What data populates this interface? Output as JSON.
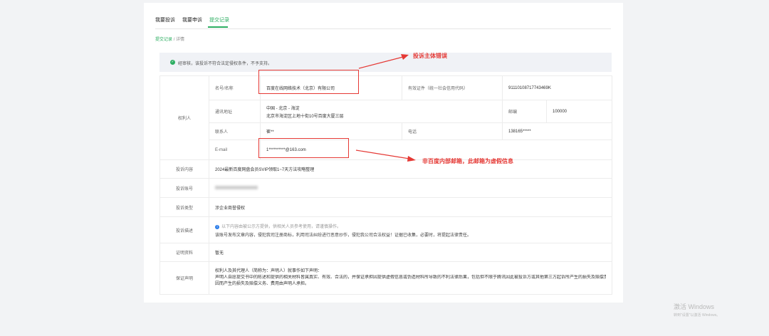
{
  "tabs": [
    {
      "label": "我要投诉"
    },
    {
      "label": "我要申诉"
    },
    {
      "label": "提交记录",
      "active": true
    }
  ],
  "breadcrumb": {
    "back": "提交记录",
    "separator": "/",
    "current": "详情"
  },
  "notice": {
    "status_icon": "check-circle-icon",
    "text": "经审核，该投诉不符合法定侵权条件，不予支持。"
  },
  "rights_holder": {
    "section_label": "权利人",
    "name_label": "名号/名称",
    "name_value": "百度在线网络技术（北京）有限公司",
    "cert_label": "有效证件（统一社会信用代码）",
    "cert_value": "91110108717743469K",
    "address_label": "通讯地址",
    "address_region": "中国 - 北京 - 海淀",
    "address_detail": "北京市海淀区上地十街10号百度大厦三层",
    "postcode_label": "邮编",
    "postcode_value": "100000",
    "contact_label": "联系人",
    "contact_value": "崔**",
    "phone_label": "电话",
    "phone_value": "138165*****",
    "email_label": "E-mail",
    "email_value": "1**********@163.com"
  },
  "rows": {
    "content_label": "投诉内容",
    "content_value": "2024最新百度网盘会员SVIP领取1~7天方法攻略整理",
    "account_label": "投诉账号",
    "type_label": "投诉类型",
    "type_value": "涉企业商誉侵权",
    "desc_label": "投诉描述",
    "desc_hint": "以下内容由被公示方提供，供相关人员参考使用，请谨慎操作。",
    "desc_text": "该账号发布文章内容，侵犯我司注册商标，利用司法纠纷进行恶意炒作，侵犯我公司合法权益！证据已收集，必要时，将提起法律责任。",
    "evidence_label": "证明资料",
    "evidence_value": "暂无",
    "guarantee_label": "保证声明",
    "guarantee_line1": "权利人及其代理人（简称为：声明人）就事作如下声明：",
    "guarantee_line2": "声明人自愿提交书中的陈述和提供的相关材料皆属真实、有效、合法的，并保证承担因提供虚假信息或伪造材料所导致的不利法律后果，包括但不限于腾讯因此被投诉方或其他第三方起诉所产生的损失及赔偿责任。",
    "guarantee_line3": "因而产生的损失及赔偿义务、费用由声明人承担。"
  },
  "annotations": {
    "entity_error": "投诉主体错误",
    "email_note": "非百度内部邮箱，此邮箱为虚假信息",
    "color": "#e53935"
  },
  "watermark": {
    "line1": "激活 Windows",
    "line2": "转到\"设置\"以激活 Windows。"
  }
}
